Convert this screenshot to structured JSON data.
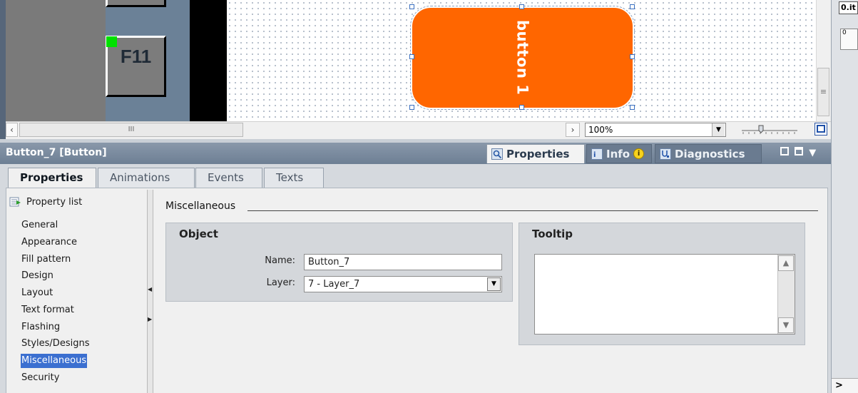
{
  "canvas": {
    "fkey_label": "F11",
    "button_label": "button 1",
    "zoom_value": "100%"
  },
  "inspector": {
    "title": "Button_7 [Button]",
    "tabs": [
      {
        "label": "Properties"
      },
      {
        "label": "Info"
      },
      {
        "label": "Diagnostics"
      }
    ],
    "subtabs": [
      {
        "label": "Properties"
      },
      {
        "label": "Animations"
      },
      {
        "label": "Events"
      },
      {
        "label": "Texts"
      }
    ],
    "property_list_label": "Property list",
    "categories": [
      {
        "label": "General"
      },
      {
        "label": "Appearance"
      },
      {
        "label": "Fill pattern"
      },
      {
        "label": "Design"
      },
      {
        "label": "Layout"
      },
      {
        "label": "Text format"
      },
      {
        "label": "Flashing"
      },
      {
        "label": "Styles/Designs"
      },
      {
        "label": "Miscellaneous",
        "selected": true
      },
      {
        "label": "Security"
      }
    ],
    "section_title": "Miscellaneous",
    "object_group": {
      "title": "Object",
      "name_label": "Name:",
      "name_value": "Button_7",
      "layer_label": "Layer:",
      "layer_value": "7 - Layer_7"
    },
    "tooltip_group": {
      "title": "Tooltip",
      "text": ""
    }
  },
  "right_strip": {
    "top_text": "0.it",
    "second_text": "0",
    "bottom_text": ">"
  },
  "colors": {
    "button_fill": "#ff6600",
    "selection": "#3b6fd0",
    "header": "#7b8ca0"
  }
}
